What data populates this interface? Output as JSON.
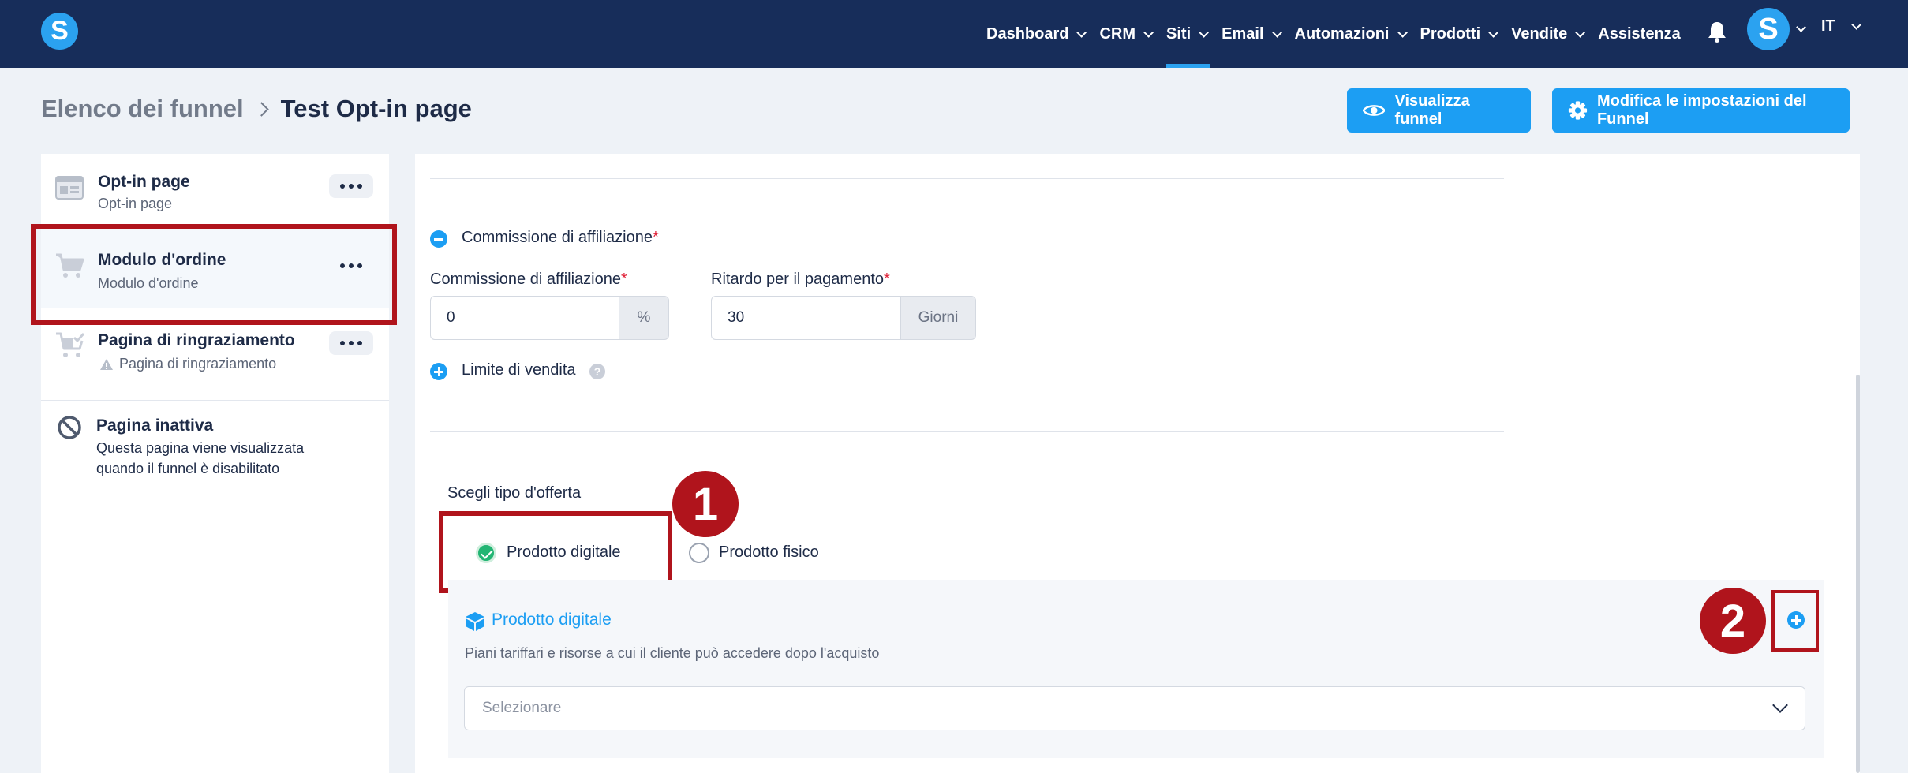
{
  "nav": {
    "logo": "S",
    "items": [
      {
        "label": "Dashboard",
        "has_chevron": true
      },
      {
        "label": "CRM",
        "has_chevron": true
      },
      {
        "label": "Siti",
        "has_chevron": true,
        "active": true
      },
      {
        "label": "Email",
        "has_chevron": true
      },
      {
        "label": "Automazioni",
        "has_chevron": true
      },
      {
        "label": "Prodotti",
        "has_chevron": true
      },
      {
        "label": "Vendite",
        "has_chevron": true
      },
      {
        "label": "Assistenza",
        "has_chevron": false
      }
    ],
    "avatar": "S",
    "language": "IT",
    "active_color": "#2ba2f0",
    "bg_color": "#172d5a"
  },
  "breadcrumb": {
    "parent": "Elenco dei funnel",
    "current": "Test Opt-in page"
  },
  "actions": {
    "view_funnel": "Visualizza funnel",
    "edit_settings": "Modifica le impostazioni del Funnel"
  },
  "sidebar": {
    "items": [
      {
        "title": "Opt-in page",
        "subtitle": "Opt-in page",
        "icon": "page-icon"
      },
      {
        "title": "Modulo d'ordine",
        "subtitle": "Modulo d'ordine",
        "icon": "cart-icon",
        "selected": true
      },
      {
        "title": "Pagina di ringraziamento",
        "subtitle": "Pagina di ringraziamento",
        "icon": "cart-check-icon",
        "warning": true
      },
      {
        "title": "Pagina inattiva",
        "subtitle": "Questa pagina viene visualizzata",
        "subtitle2": "quando il funnel è disabilitato",
        "icon": "disabled-icon"
      }
    ]
  },
  "form": {
    "affiliate_section": "Commissione di affiliazione",
    "affiliate_commission_label": "Commissione di affiliazione",
    "affiliate_commission_value": "0",
    "affiliate_commission_unit": "%",
    "payment_delay_label": "Ritardo per il pagamento",
    "payment_delay_value": "30",
    "payment_delay_unit": "Giorni",
    "sales_limit": "Limite di vendita",
    "help": "?",
    "offer_type_label": "Scegli tipo d'offerta",
    "offer_digital": "Prodotto digitale",
    "offer_physical": "Prodotto fisico",
    "product_heading": "Prodotto digitale",
    "product_description": "Piani tariffari e risorse a cui il cliente può accedere dopo l'acquisto",
    "product_select_placeholder": "Selezionare"
  },
  "annotations": {
    "badge_1": "1",
    "badge_2": "2",
    "color": "#b0141c"
  }
}
